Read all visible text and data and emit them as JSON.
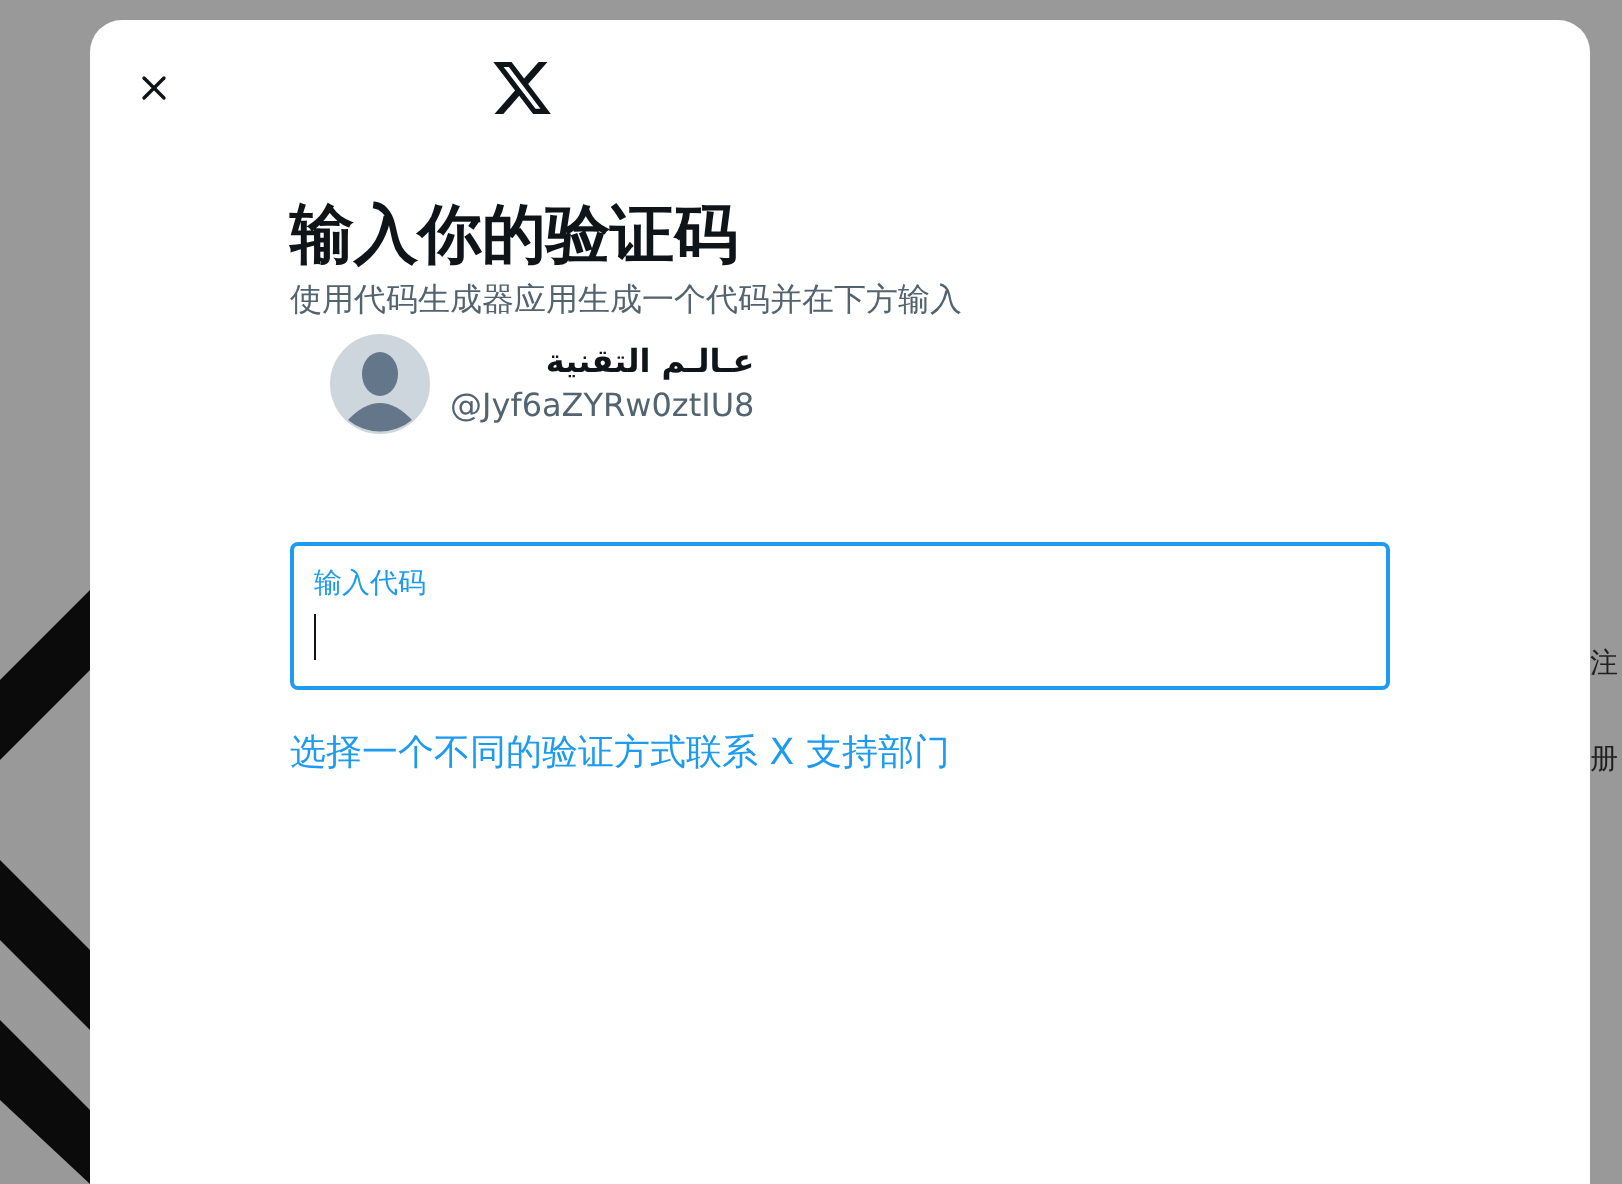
{
  "background": {
    "side_texts": [
      "注",
      "册"
    ]
  },
  "dialog": {
    "title": "输入你的验证码",
    "subtitle": "使用代码生成器应用生成一个代码并在下方输入",
    "account": {
      "name": "عـالـم التقنية",
      "handle": "@Jyf6aZYRw0ztIU8"
    },
    "code_field": {
      "label": "输入代码",
      "focused": true
    },
    "links": [
      "选择一个不同的验证方式",
      "联系 X 支持部门"
    ]
  }
}
